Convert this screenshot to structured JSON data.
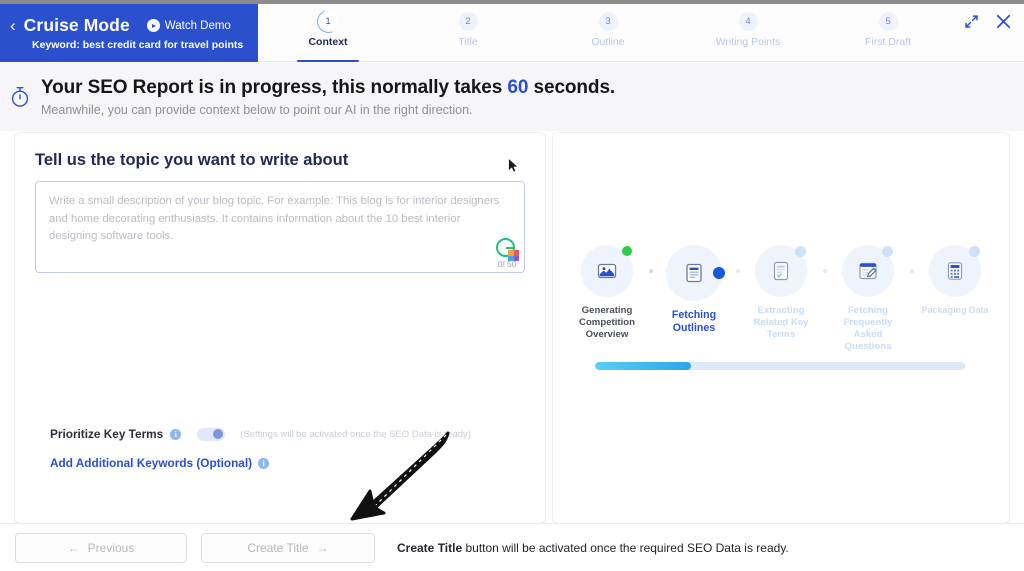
{
  "header": {
    "back_icon": "chevron-left-icon",
    "mode_title": "Cruise Mode",
    "watch_demo_label": "Watch Demo",
    "keyword_line": "Keyword: best credit card for travel points",
    "expand_icon": "expand-icon",
    "close_icon": "close-icon",
    "steps": [
      {
        "number": "1",
        "label": "Context",
        "state": "active"
      },
      {
        "number": "2",
        "label": "Title",
        "state": "pending"
      },
      {
        "number": "3",
        "label": "Outline",
        "state": "pending"
      },
      {
        "number": "4",
        "label": "Writing Points",
        "state": "pending"
      },
      {
        "number": "5",
        "label": "First Draft",
        "state": "pending"
      }
    ]
  },
  "banner": {
    "icon": "stopwatch-icon",
    "line1_before": "Your SEO Report is in progress, this normally takes ",
    "line1_number": "60",
    "line1_after": " seconds.",
    "line2": "Meanwhile, you can provide context below to point our AI in the right direction."
  },
  "left_panel": {
    "title": "Tell us the topic you want to write about",
    "textarea_placeholder": "Write a small description of your blog topic. For example: This blog is for interior designers and home decorating enthusiasts. It contains information about the 10 best interior designing software tools.",
    "textarea_value": "",
    "char_count": "0/ 50",
    "grammarly_icon": "grammarly-icon",
    "prioritize_label": "Prioritize Key Terms",
    "prioritize_info_icon": "info-icon",
    "prioritize_toggle_state": "off",
    "prioritize_note": "(Settings will be activated once the SEO Data is ready)",
    "add_keywords_label": "Add Additional Keywords (Optional)",
    "add_keywords_info_icon": "info-icon"
  },
  "right_panel": {
    "stages": [
      {
        "label": "Generating Competition Overview",
        "icon": "chart-image-icon",
        "state": "done",
        "dot_color": "#2ecc40"
      },
      {
        "label": "Fetching Outlines",
        "icon": "document-icon",
        "state": "active",
        "dot_color": "#1359d8"
      },
      {
        "label": "Extracting Related Key Terms",
        "icon": "checklist-icon",
        "state": "pending",
        "dot_color": "#cfe0f7"
      },
      {
        "label": "Fetching Frequently Asked Questions",
        "icon": "edit-window-icon",
        "state": "pending",
        "dot_color": "#cfe0f7"
      },
      {
        "label": "Packaging Data",
        "icon": "calculator-icon",
        "state": "pending",
        "dot_color": "#cfe0f7"
      }
    ],
    "progress_percent": "26"
  },
  "footer": {
    "previous_label": "Previous",
    "previous_icon": "arrow-left-icon",
    "create_title_label": "Create Title",
    "create_title_icon": "arrow-right-icon",
    "note_bold": "Create Title",
    "note_rest": " button will be activated once the required SEO Data is ready."
  },
  "annotation": {
    "arrow": "hand-drawn-arrow-down-left"
  },
  "colors": {
    "brand_blue": "#2b50cd",
    "banner_bg": "#f6f6f8",
    "progress_cyan": "#5ccef5",
    "done_green": "#2ecc40"
  }
}
